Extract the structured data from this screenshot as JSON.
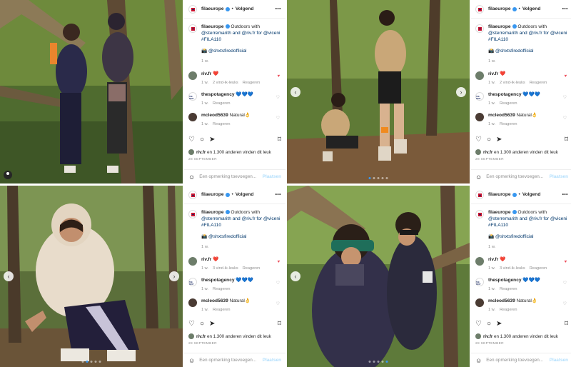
{
  "posts": [
    {
      "username": "filaeurope",
      "follow_label": "Volgend",
      "more_label": "•••",
      "caption_user": "filaeurope",
      "caption_line1": "Outdoors with",
      "caption_line2": "@sterremarith and @riv.fr for @viceni",
      "caption_line3": "#FILA110",
      "caption_handle": "📸 @shxtsfiredofficial",
      "caption_time": "1 w.",
      "comments": [
        {
          "user": "riv.fr",
          "text": "❤️",
          "time": "1 w.",
          "likes": "2 vind-ik-leuks",
          "reply": "Reageren",
          "liked": true
        },
        {
          "user": "thespotagency",
          "text": "💙💙💙",
          "time": "1 w.",
          "likes": "",
          "reply": "Reageren",
          "liked": false
        },
        {
          "user": "mcleod5639",
          "text": "Natural👌",
          "time": "1 w.",
          "likes": "",
          "reply": "Reageren",
          "liked": false
        }
      ],
      "liked_by": "riv.fr",
      "likes_rest": "en 1.300 anderen vinden dit leuk",
      "date": "28 SEPTEMBER",
      "add_comment_placeholder": "Een opmerking toevoegen...",
      "post_label": "Plaatsen"
    },
    {
      "username": "filaeurope",
      "follow_label": "Volgend",
      "more_label": "•••",
      "caption_user": "filaeurope",
      "caption_line1": "Outdoors with",
      "caption_line2": "@sterremarith and @riv.fr for @viceni",
      "caption_line3": "#FILA110",
      "caption_handle": "📸 @shxtsfiredofficial",
      "caption_time": "1 w.",
      "comments": [
        {
          "user": "riv.fr",
          "text": "❤️",
          "time": "1 w.",
          "likes": "2 vind-ik-leuks",
          "reply": "Reageren",
          "liked": true
        },
        {
          "user": "thespotagency",
          "text": "💙💙💙",
          "time": "1 w.",
          "likes": "",
          "reply": "Reageren",
          "liked": false
        },
        {
          "user": "mcleod5639",
          "text": "Natural👌",
          "time": "1 w.",
          "likes": "",
          "reply": "Reageren",
          "liked": false
        }
      ],
      "liked_by": "riv.fr",
      "likes_rest": "en 1.300 anderen vinden dit leuk",
      "date": "28 SEPTEMBER",
      "add_comment_placeholder": "Een opmerking toevoegen...",
      "post_label": "Plaatsen"
    },
    {
      "username": "filaeurope",
      "follow_label": "Volgend",
      "more_label": "•••",
      "caption_user": "filaeurope",
      "caption_line1": "Outdoors with",
      "caption_line2": "@sterremarith and @riv.fr for @viceni",
      "caption_line3": "#FILA110",
      "caption_handle": "📸 @shxtsfiredofficial",
      "caption_time": "1 w.",
      "comments": [
        {
          "user": "riv.fr",
          "text": "❤️",
          "time": "1 w.",
          "likes": "3 vind-ik-leuks",
          "reply": "Reageren",
          "liked": true
        },
        {
          "user": "thespotagency",
          "text": "💙💙💙",
          "time": "1 w.",
          "likes": "",
          "reply": "Reageren",
          "liked": false
        },
        {
          "user": "mcleod5639",
          "text": "Natural👌",
          "time": "1 w.",
          "likes": "",
          "reply": "Reageren",
          "liked": false
        }
      ],
      "liked_by": "riv.fr",
      "likes_rest": "en 1.300 anderen vinden dit leuk",
      "date": "28 SEPTEMBER",
      "add_comment_placeholder": "Een opmerking toevoegen...",
      "post_label": "Plaatsen"
    },
    {
      "username": "filaeurope",
      "follow_label": "Volgend",
      "more_label": "•••",
      "caption_user": "filaeurope",
      "caption_line1": "Outdoors with",
      "caption_line2": "@sterremarith and @riv.fr for @viceni",
      "caption_line3": "#FILA110",
      "caption_handle": "📸 @shxtsfiredofficial",
      "caption_time": "1 w.",
      "comments": [
        {
          "user": "riv.fr",
          "text": "❤️",
          "time": "1 w.",
          "likes": "3 vind-ik-leuks",
          "reply": "Reageren",
          "liked": true
        },
        {
          "user": "thespotagency",
          "text": "💙💙💙",
          "time": "1 w.",
          "likes": "",
          "reply": "Reageren",
          "liked": false
        },
        {
          "user": "mcleod5639",
          "text": "Natural👌",
          "time": "1 w.",
          "likes": "",
          "reply": "Reageren",
          "liked": false
        }
      ],
      "liked_by": "riv.fr",
      "likes_rest": "en 1.300 anderen vinden dit leuk",
      "date": "28 SEPTEMBER",
      "add_comment_placeholder": "Een opmerking toevoegen...",
      "post_label": "Plaatsen"
    }
  ],
  "icons": {
    "prev": "‹",
    "next": "›",
    "heart": "♡",
    "comment": "○",
    "share": "➤",
    "save": "⌑",
    "emoji": "☺"
  },
  "colors": {
    "link_blue": "#00376b",
    "verified_blue": "#3897f0",
    "like_red": "#ed4956",
    "muted_grey": "#8e8e8e",
    "post_button_disabled": "#b2dffc",
    "fila_red": "#c8102e",
    "fila_navy": "#1b2b63"
  }
}
